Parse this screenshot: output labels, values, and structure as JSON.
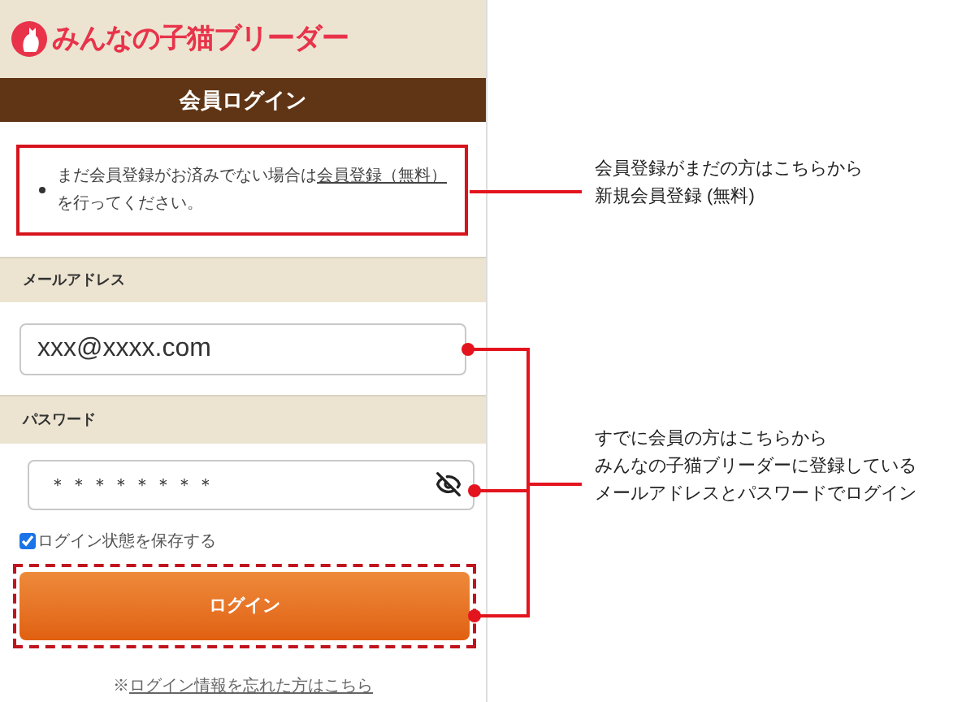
{
  "header": {
    "logo_text": "みんなの子猫ブリーダー"
  },
  "title": "会員ログイン",
  "notice": {
    "text": "まだ会員登録がお済みでない場合は",
    "link": "会員登録（無料）",
    "suffix": "を行ってください。"
  },
  "email": {
    "label": "メールアドレス",
    "value": "xxx@xxxx.com"
  },
  "password": {
    "label": "パスワード",
    "value": "＊＊＊＊＊＊＊＊"
  },
  "remember": {
    "label": "ログイン状態を保存する",
    "checked": true
  },
  "login_button": {
    "label": "ログイン"
  },
  "forgot": {
    "prefix": "※",
    "link": "ログイン情報を忘れた方はこちら"
  },
  "annotations": [
    {
      "lines": [
        "会員登録がまだの方はこちらから",
        "新規会員登録 (無料)"
      ]
    },
    {
      "lines": [
        "すでに会員の方はこちらから",
        "みんなの子猫ブリーダーに登録している",
        "メールアドレスとパスワードでログイン"
      ]
    }
  ]
}
